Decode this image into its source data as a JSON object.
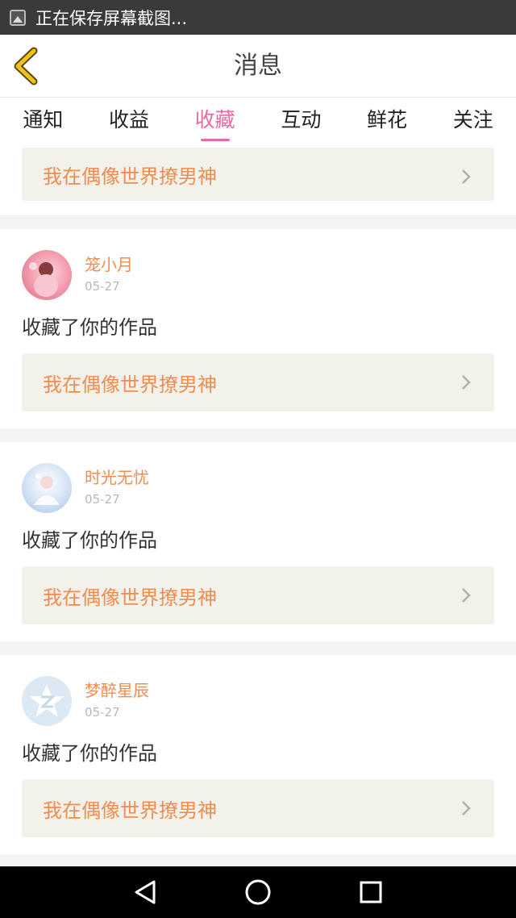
{
  "status_bar": {
    "text": "正在保存屏幕截图..."
  },
  "header": {
    "title": "消息"
  },
  "tabs": [
    {
      "label": "通知",
      "active": false
    },
    {
      "label": "收益",
      "active": false
    },
    {
      "label": "收藏",
      "active": true
    },
    {
      "label": "互动",
      "active": false
    },
    {
      "label": "鲜花",
      "active": false
    },
    {
      "label": "关注",
      "active": false
    }
  ],
  "first_card": {
    "work_title": "我在偶像世界撩男神"
  },
  "messages": [
    {
      "user": "笼小月",
      "date": "05-27",
      "action": "收藏了你的作品",
      "work_title": "我在偶像世界撩男神"
    },
    {
      "user": "时光无忧",
      "date": "05-27",
      "action": "收藏了你的作品",
      "work_title": "我在偶像世界撩男神"
    },
    {
      "user": "梦醉星辰",
      "date": "05-27",
      "action": "收藏了你的作品",
      "work_title": "我在偶像世界撩男神"
    }
  ],
  "icons": {
    "back": "chevron-left-icon",
    "chevron": "chevron-right-icon",
    "nav": [
      "back-triangle-icon",
      "home-circle-icon",
      "recents-square-icon"
    ]
  },
  "colors": {
    "accent": "#e86aa5",
    "username": "#f08c50",
    "work_title": "#f08c50",
    "back_arrow": "#f0c21c"
  }
}
